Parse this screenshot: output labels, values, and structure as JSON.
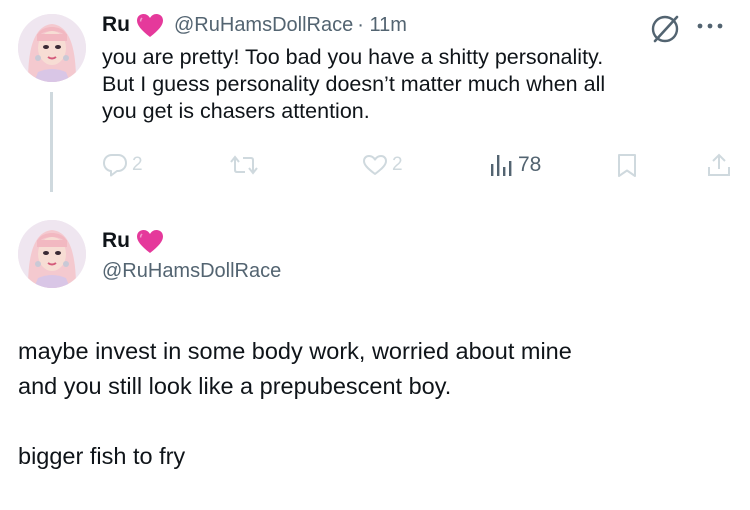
{
  "reply_tweet": {
    "author_name": "Ru",
    "verified_emoji": "pink-heart",
    "handle": "@RuHamsDollRace",
    "timestamp": "· 11m",
    "text_lines": [
      "you are pretty! Too bad you have a shitty personality.",
      "But I guess personality doesn’t matter much when all",
      "you get is chasers attention."
    ],
    "actions": {
      "replies": "2",
      "retweets": "",
      "likes": "2",
      "views": "78"
    }
  },
  "main_tweet": {
    "author_name": "Ru",
    "verified_emoji": "pink-heart",
    "handle": "@RuHamsDollRace",
    "text_lines": [
      "maybe invest in some body work, worried about mine",
      "and you still look like a prepubescent boy.",
      "",
      "bigger fish to fry"
    ]
  },
  "colors": {
    "heart": "#e5399b",
    "muted": "#536471",
    "faint_icon": "#cfd9de",
    "text": "#0f1419"
  }
}
